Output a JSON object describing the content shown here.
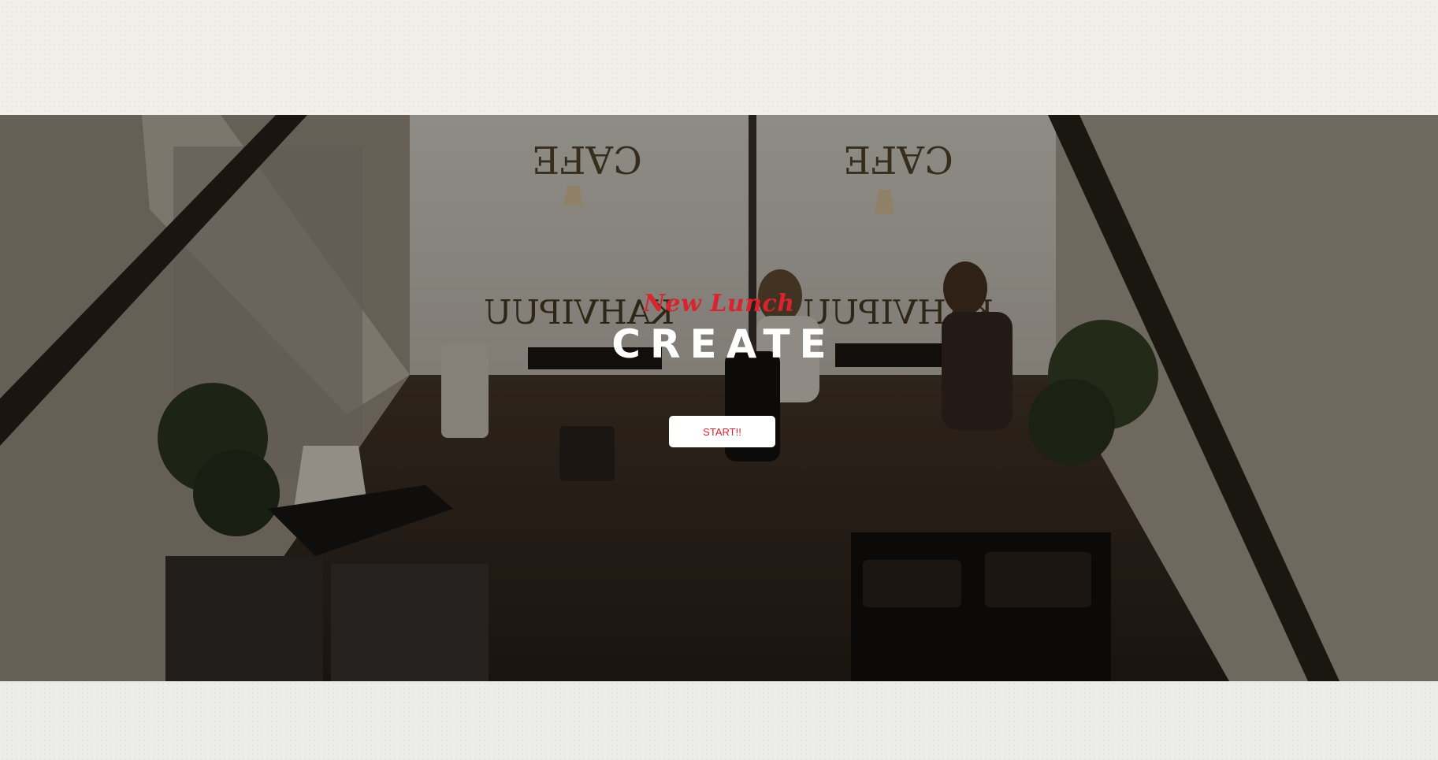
{
  "hero": {
    "subtitle": "New Lunch",
    "title": "CREATE",
    "button_label": "START!!",
    "background_image": "cafe interior viewed from above with two women seated at a table by the window"
  },
  "colors": {
    "accent": "#d9232e",
    "title": "#ffffff",
    "button_bg": "#ffffff",
    "top_band": "#f1efe9",
    "bottom_band": "#ececea"
  }
}
